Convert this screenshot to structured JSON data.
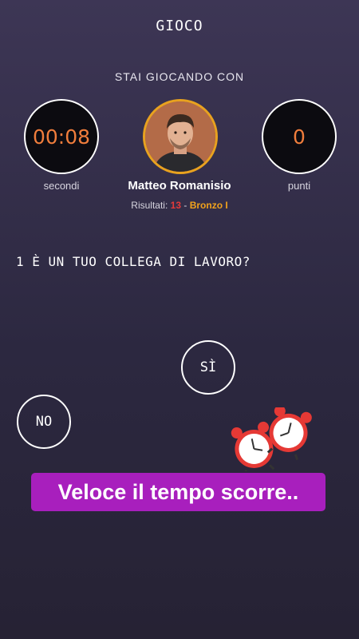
{
  "header": {
    "title": "GIOCO"
  },
  "opponent": {
    "intro": "STAI GIOCANDO CON",
    "name": "Matteo Romanisio",
    "results_label": "Risultati:",
    "results_value": "13",
    "results_separator": "-",
    "rank": "Bronzo I"
  },
  "timer": {
    "value": "00:08",
    "label": "secondi"
  },
  "score": {
    "value": "0",
    "label": "punti"
  },
  "question": {
    "text": "1 È UN TUO COLLEGA DI LAVORO?"
  },
  "answers": {
    "yes": "SÌ",
    "no": "NO"
  },
  "sticker": {
    "icon": "alarm-clock-icon",
    "text": "Veloce il tempo scorre.."
  },
  "colors": {
    "timer": "#f07d3c",
    "avatar_ring": "#e8a21f",
    "results_number": "#e43a3a",
    "rank": "#f0a21c",
    "banner": "#a81fbd"
  }
}
